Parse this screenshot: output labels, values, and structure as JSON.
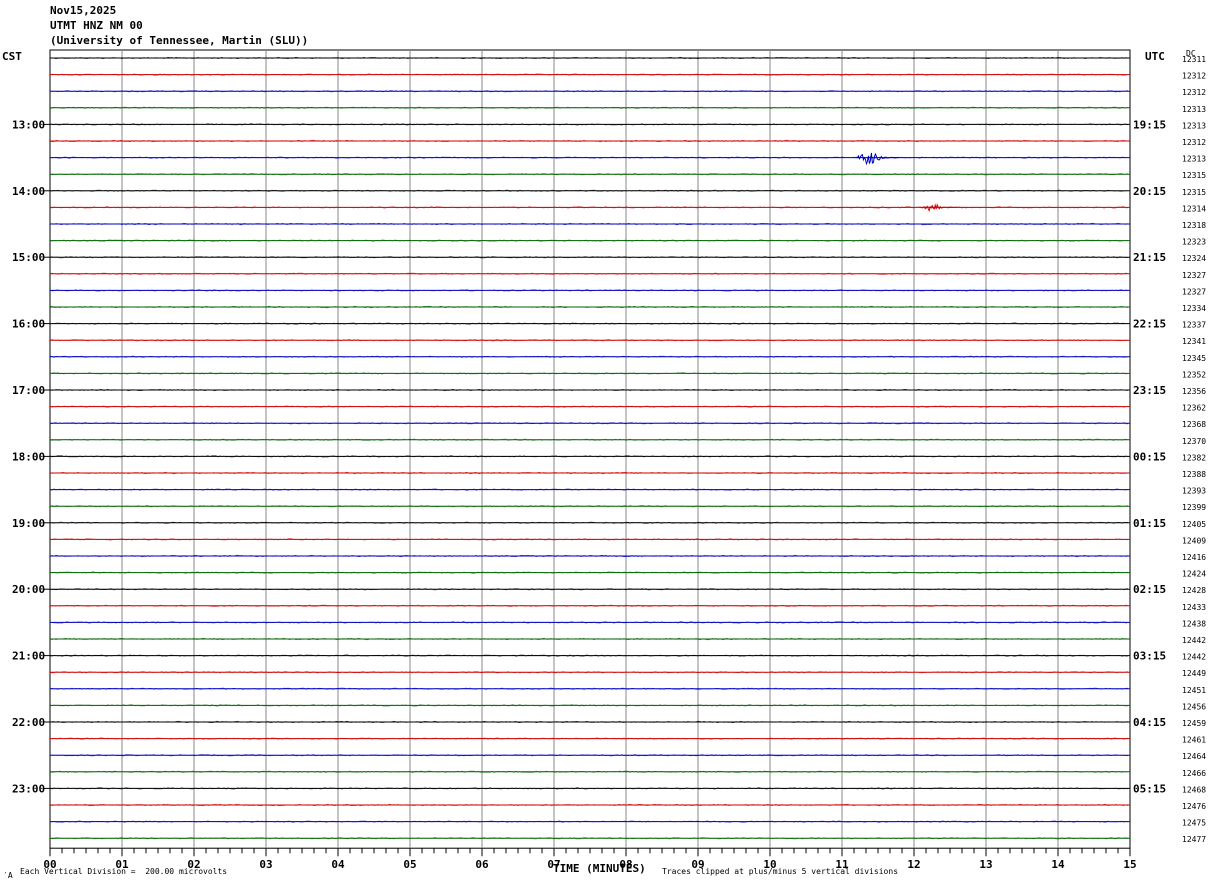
{
  "header": {
    "date": "Nov15,2025",
    "station": "UTMT HNZ NM 00",
    "institution": "(University of Tennessee, Martin (SLU))"
  },
  "labels": {
    "left_zone": "CST",
    "right_zone": "UTC",
    "dc_header": "DC",
    "x_axis_title": "TIME (MINUTES)",
    "vertical_division": "Each Vertical Division =  200.00 microvolts",
    "clip_note": "Traces clipped at plus/minus 5 vertical divisions",
    "corner_mark": "′A"
  },
  "colors": {
    "traces": [
      "#000000",
      "#d00000",
      "#0000c0",
      "#006400"
    ],
    "grid": "#888888"
  },
  "chart_data": {
    "type": "line",
    "description_kind": "helicorder",
    "x_axis": {
      "label": "TIME (MINUTES)",
      "range": [
        0,
        15
      ],
      "ticks": [
        "00",
        "01",
        "02",
        "03",
        "04",
        "05",
        "06",
        "07",
        "08",
        "09",
        "10",
        "11",
        "12",
        "13",
        "14",
        "15"
      ]
    },
    "cst_hour_labels": [
      "13:00",
      "14:00",
      "15:00",
      "16:00",
      "17:00",
      "18:00",
      "19:00",
      "20:00",
      "21:00",
      "22:00",
      "23:00"
    ],
    "utc_hour_labels": [
      "19:15",
      "20:15",
      "21:15",
      "22:15",
      "23:15",
      "00:15",
      "01:15",
      "02:15",
      "03:15",
      "04:15",
      "05:15"
    ],
    "dc_offsets": [
      "12311",
      "12312",
      "12312",
      "12313",
      "12313",
      "12312",
      "12313",
      "12315",
      "12315",
      "12314",
      "12318",
      "12323",
      "12324",
      "12327",
      "12327",
      "12334",
      "12337",
      "12341",
      "12345",
      "12352",
      "12356",
      "12362",
      "12368",
      "12370",
      "12382",
      "12388",
      "12393",
      "12399",
      "12405",
      "12409",
      "12416",
      "12424",
      "12428",
      "12433",
      "12438",
      "12442",
      "12442",
      "12449",
      "12451",
      "12456",
      "12459",
      "12461",
      "12464",
      "12466",
      "12468",
      "12476",
      "12475",
      "12477"
    ],
    "events": [
      {
        "trace_index": 6,
        "start_minute": 11.2,
        "end_minute": 11.8,
        "amplitude": "moderate"
      },
      {
        "trace_index": 9,
        "start_minute": 12.1,
        "end_minute": 12.6,
        "amplitude": "small"
      }
    ]
  }
}
